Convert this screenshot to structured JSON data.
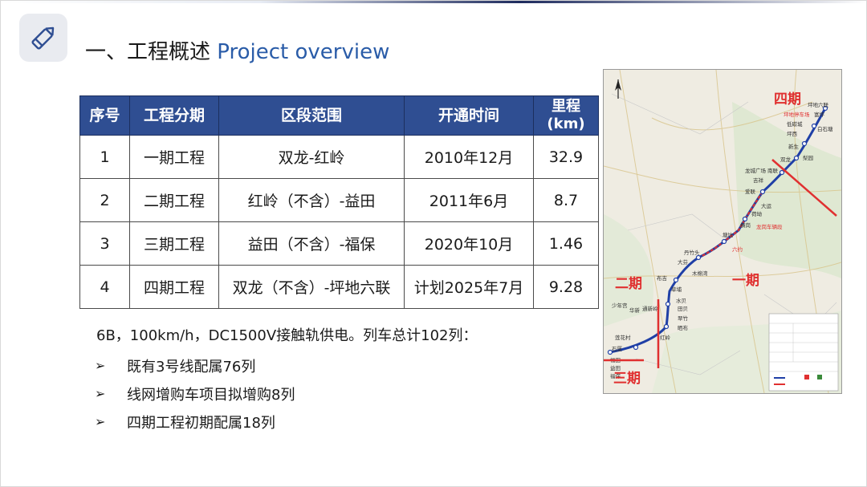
{
  "title": {
    "cn": "一、工程概述",
    "en": "Project overview"
  },
  "table": {
    "headers": [
      "序号",
      "工程分期",
      "区段范围",
      "开通时间",
      "里程(km)"
    ],
    "rows": [
      [
        "1",
        "一期工程",
        "双龙-红岭",
        "2010年12月",
        "32.9"
      ],
      [
        "2",
        "二期工程",
        "红岭（不含）-益田",
        "2011年6月",
        "8.7"
      ],
      [
        "3",
        "三期工程",
        "益田（不含）-福保",
        "2020年10月",
        "1.46"
      ],
      [
        "4",
        "四期工程",
        "双龙（不含）-坪地六联",
        "计划2025年7月",
        "9.28"
      ]
    ]
  },
  "summary": "6B，100km/h，DC1500V接触轨供电。列车总计102列：",
  "bullets": [
    "既有3号线配属76列",
    "线网增购车项目拟增购8列",
    "四期工程初期配属18列"
  ],
  "map": {
    "phase_labels": {
      "phase4": "四期",
      "phase1": "一期",
      "phase2": "二期",
      "phase3": "三期"
    },
    "stations": [
      "坪地六联",
      "富坪",
      "白石塘",
      "坪西",
      "坪地停车场",
      "低碳城",
      "新生",
      "双龙",
      "梨园",
      "龙城广场",
      "吉祥",
      "南联",
      "龙城广场",
      "爱联",
      "大运",
      "荷坳",
      "横岗",
      "龙岗车辆段",
      "塘坑",
      "六约",
      "丹竹头",
      "大芬",
      "木棉湾",
      "布吉",
      "草埔",
      "水贝",
      "田贝",
      "翠竹",
      "晒布",
      "红岭",
      "通新岭",
      "华新",
      "莲花村",
      "少年宫",
      "石厦",
      "福田",
      "益田",
      "福保"
    ],
    "colors": {
      "line": "#1f3fa6",
      "phase_line": "#e03030",
      "label": "#e03030"
    }
  }
}
